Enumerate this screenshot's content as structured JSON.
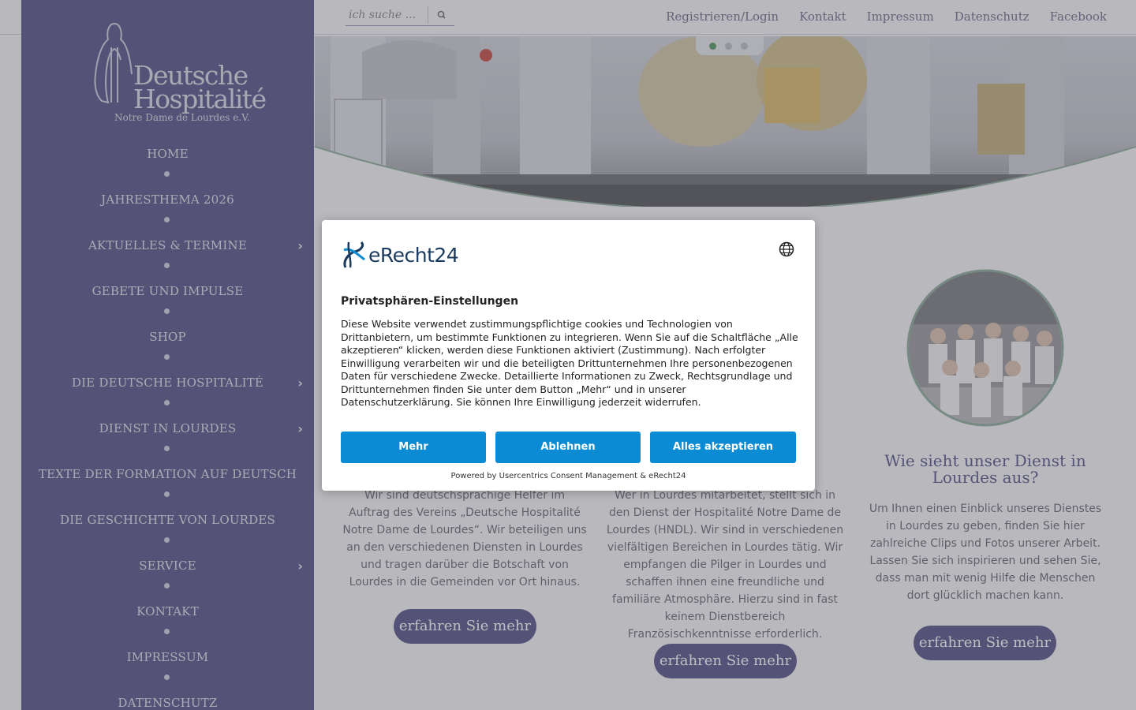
{
  "logo": {
    "line1": "Deutsche",
    "line2": "Hospitalité",
    "sub": "Notre Dame de Lourdes e.V."
  },
  "nav": {
    "items": [
      {
        "label": "HOME",
        "submenu": false
      },
      {
        "label": "JAHRESTHEMA 2026",
        "submenu": false
      },
      {
        "label": "AKTUELLES & TERMINE",
        "submenu": true
      },
      {
        "label": "GEBETE UND IMPULSE",
        "submenu": false
      },
      {
        "label": "SHOP",
        "submenu": false
      },
      {
        "label": "DIE DEUTSCHE HOSPITALITÉ",
        "submenu": true
      },
      {
        "label": "DIENST IN LOURDES",
        "submenu": true
      },
      {
        "label": "TEXTE DER FORMATION AUF DEUTSCH",
        "submenu": false
      },
      {
        "label": "DIE GESCHICHTE VON LOURDES",
        "submenu": false
      },
      {
        "label": "SERVICE",
        "submenu": true
      },
      {
        "label": "KONTAKT",
        "submenu": false
      },
      {
        "label": "IMPRESSUM",
        "submenu": false
      },
      {
        "label": "DATENSCHUTZ",
        "submenu": false
      }
    ]
  },
  "search": {
    "placeholder": "ich suche ..."
  },
  "topnav": [
    "Registrieren/Login",
    "Kontakt",
    "Impressum",
    "Datenschutz",
    "Facebook"
  ],
  "slider": {
    "slides": 3,
    "active": 1
  },
  "columns": [
    {
      "text": "Wir sind deutschsprachige Helfer im Auftrag des Vereins „Deutsche Hospitalité Notre Dame de Lourdes“. Wir beteiligen uns an den verschiedenen Diensten in Lourdes und tragen darüber die Botschaft von Lourdes in die Gemeinden vor Ort hinaus.",
      "button": "erfahren Sie mehr"
    },
    {
      "text": "Wer in Lourdes mitarbeitet, stellt sich in den Dienst der Hospitalité Notre Dame de Lourdes (HNDL). Wir sind in verschiedenen vielfältigen Bereichen in Lourdes tätig. Wir empfangen die Pilger in Lourdes und schaffen ihnen eine freundliche und familiäre Atmosphäre. Hierzu sind in fast keinem Dienstbereich Französischkenntnisse erforderlich.",
      "button": "erfahren Sie mehr"
    },
    {
      "title": "Wie sieht unser Dienst in Lourdes aus?",
      "text": "Um Ihnen einen Einblick unseres Dienstes in Lourdes zu geben, finden Sie hier zahlreiche Clips und Fotos unserer Arbeit. Lassen Sie sich inspirieren und sehen Sie, dass man mit wenig Hilfe die Menschen dort glücklich machen kann.",
      "button": "erfahren Sie mehr"
    }
  ],
  "consent": {
    "brand": "eRecht24",
    "title": "Privatsphären-Einstellungen",
    "body": "Diese Website verwendet zustimmungspflichtige cookies und Technologien von Drittanbietern, um bestimmte Funktionen zu integrieren. Wenn Sie auf die Schaltfläche „Alle akzeptieren“ klicken, werden diese Funktionen aktiviert (Zustimmung). Nach erfolgter Einwilligung verarbeiten wir und die beteiligten Drittunternehmen Ihre personenbezogenen Daten für verschiedene Zwecke. Detaillierte Informationen zu Zweck, Rechtsgrundlage und Drittunternehmen finden Sie unter dem Button „Mehr“ und in unserer Datenschutzerklärung. Sie können Ihre Einwilligung jederzeit widerrufen.",
    "buttons": {
      "more": "Mehr",
      "decline": "Ablehnen",
      "accept": "Alles akzeptieren"
    },
    "footer": "Powered by Usercentrics Consent Management & eRecht24"
  },
  "colors": {
    "brand": "#3e3d77",
    "accent": "#0a8bd3",
    "sliderActive": "#3f8a4a"
  }
}
